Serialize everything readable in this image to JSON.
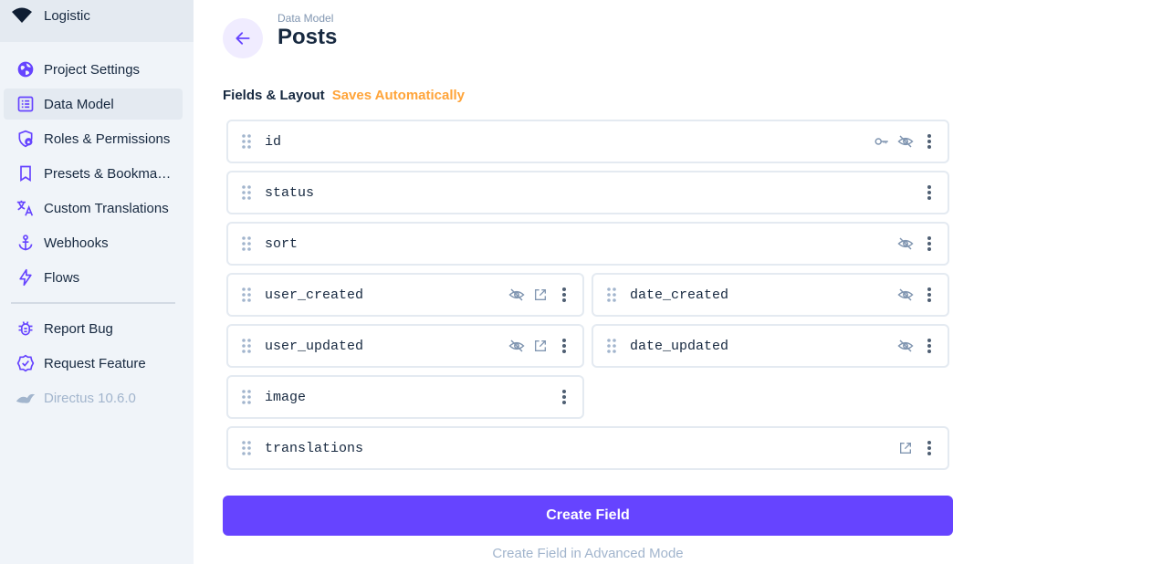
{
  "colors": {
    "accent": "#6644ff",
    "saves": "#ffa439",
    "icon": "#6644ff"
  },
  "sidebar": {
    "project_name": "Logistic",
    "items": [
      {
        "label": "Project Settings",
        "icon": "globe-icon"
      },
      {
        "label": "Data Model",
        "icon": "list-alt-icon"
      },
      {
        "label": "Roles & Permissions",
        "icon": "shield-lock-icon"
      },
      {
        "label": "Presets & Bookmarks",
        "icon": "bookmark-icon"
      },
      {
        "label": "Custom Translations",
        "icon": "translate-icon"
      },
      {
        "label": "Webhooks",
        "icon": "anchor-icon"
      },
      {
        "label": "Flows",
        "icon": "bolt-icon"
      }
    ],
    "bottom_items": [
      {
        "label": "Report Bug",
        "icon": "bug-icon"
      },
      {
        "label": "Request Feature",
        "icon": "verified-icon"
      },
      {
        "label": "Directus 10.6.0",
        "icon": "rabbit-icon"
      }
    ]
  },
  "header": {
    "breadcrumb": "Data Model",
    "title": "Posts"
  },
  "section": {
    "title": "Fields & Layout",
    "saves": "Saves Automatically"
  },
  "fields": [
    {
      "name": "id",
      "actions": [
        "key-icon",
        "hidden-icon",
        "more-icon"
      ]
    },
    {
      "name": "status",
      "actions": [
        "more-icon"
      ]
    },
    {
      "name": "sort",
      "actions": [
        "hidden-icon",
        "more-icon"
      ]
    },
    {
      "name": "user_created",
      "actions": [
        "hidden-icon",
        "open-in-new-icon",
        "more-icon"
      ]
    },
    {
      "name": "date_created",
      "actions": [
        "hidden-icon",
        "more-icon"
      ]
    },
    {
      "name": "user_updated",
      "actions": [
        "hidden-icon",
        "open-in-new-icon",
        "more-icon"
      ]
    },
    {
      "name": "date_updated",
      "actions": [
        "hidden-icon",
        "more-icon"
      ]
    },
    {
      "name": "image",
      "actions": [
        "more-icon"
      ]
    },
    {
      "name": "translations",
      "actions": [
        "open-in-new-icon",
        "more-icon"
      ]
    }
  ],
  "buttons": {
    "create_field": "Create Field",
    "advanced": "Create Field in Advanced Mode"
  }
}
